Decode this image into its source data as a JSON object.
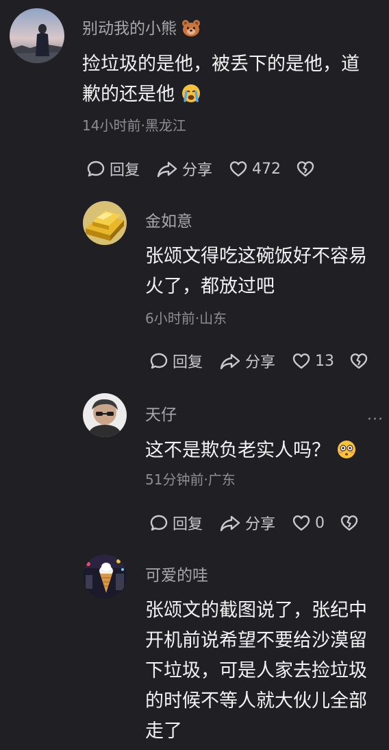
{
  "comments": [
    {
      "username": "别动我的小熊",
      "content_lines": [
        "捡垃圾的是他，被丢下的是他，道",
        "歉的还是他"
      ],
      "meta": "14小时前·黑龙江",
      "reply_label": "回复",
      "share_label": "分享",
      "likes": "472"
    },
    {
      "username": "金如意",
      "content_lines": [
        "张颂文得吃这碗饭好不容易",
        "火了，都放过吧"
      ],
      "meta": "6小时前·山东",
      "reply_label": "回复",
      "share_label": "分享",
      "likes": "13"
    },
    {
      "username": "天仔",
      "content_lines": [
        "这不是欺负老实人吗？"
      ],
      "meta": "51分钟前·广东",
      "reply_label": "回复",
      "share_label": "分享",
      "likes": "0",
      "more": "···"
    },
    {
      "username": "可爱的哇",
      "content_lines": [
        "张颂文的截图说了，张纪中",
        "开机前说希望不要给沙漠留",
        "下垃圾，可是人家去捡垃圾",
        "的时候不等人就大伙儿全部",
        "走了"
      ]
    }
  ],
  "colors": {
    "background": "#1f1f24",
    "text_primary": "#f3f3f3",
    "text_secondary": "#a7a7ad",
    "text_meta": "#8e8e94",
    "icon": "#c9c9cf"
  }
}
